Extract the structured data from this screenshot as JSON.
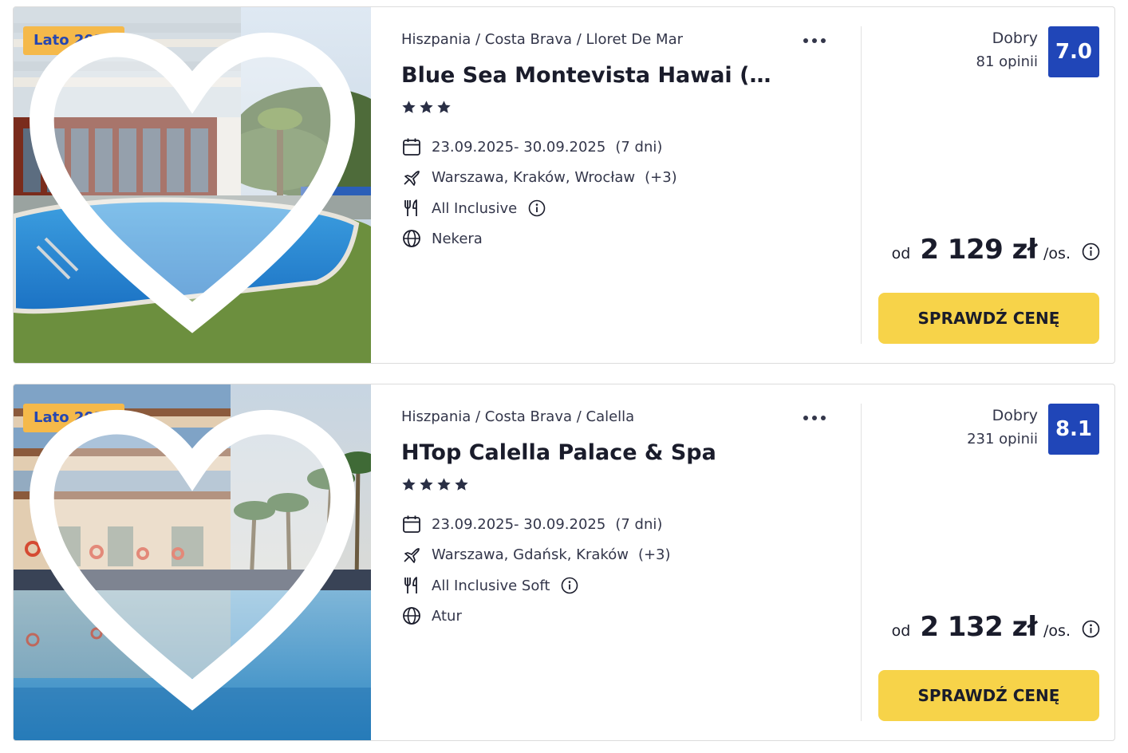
{
  "offers": [
    {
      "season_badge": "Lato 2025",
      "breadcrumb": "Hiszpania / Costa Brava / Lloret De Mar",
      "hotel_name": "Blue Sea Montevista Hawai (ex…",
      "stars": 3,
      "dates": "23.09.2025- 30.09.2025",
      "duration": "(7 dni)",
      "departures": "Warszawa, Kraków, Wrocław",
      "departures_more": "(+3)",
      "board": "All Inclusive",
      "operator": "Nekera",
      "rating_label": "Dobry",
      "rating_count": "81 opinii",
      "rating_score": "7.0",
      "price_prefix": "od",
      "price": "2 129 zł",
      "price_unit": "/os.",
      "cta_label": "SPRAWDŹ CENĘ"
    },
    {
      "season_badge": "Lato 2025",
      "breadcrumb": "Hiszpania / Costa Brava / Calella",
      "hotel_name": "HTop Calella Palace & Spa",
      "stars": 4,
      "dates": "23.09.2025- 30.09.2025",
      "duration": "(7 dni)",
      "departures": "Warszawa, Gdańsk, Kraków",
      "departures_more": "(+3)",
      "board": "All Inclusive Soft",
      "operator": "Atur",
      "rating_label": "Dobry",
      "rating_count": "231 opinii",
      "rating_score": "8.1",
      "price_prefix": "od",
      "price": "2 132 zł",
      "price_unit": "/os.",
      "cta_label": "SPRAWDŹ CENĘ"
    }
  ],
  "colors": {
    "season_badge_bg": "#f5b94a",
    "season_badge_text": "#2647b1",
    "rating_badge": "#2046b8",
    "cta_button": "#f7d349"
  },
  "icons": {
    "favorite": "heart-icon",
    "more": "more-dots-icon",
    "dates": "calendar-icon",
    "departures": "plane-icon",
    "board": "cutlery-icon",
    "operator": "globe-icon",
    "info": "info-icon",
    "rating": "star-icon"
  }
}
